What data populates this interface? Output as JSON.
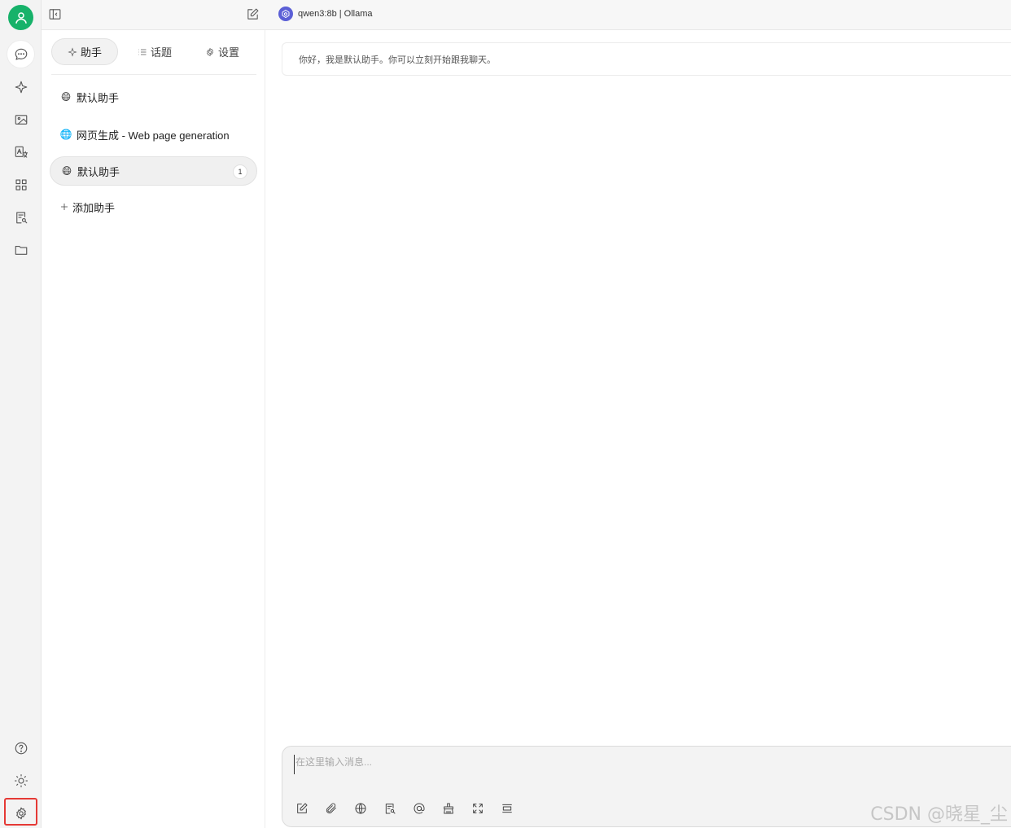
{
  "header": {
    "model_label": "qwen3:8b | Ollama"
  },
  "sidepanel": {
    "tabs": [
      {
        "label": "助手",
        "icon": "sparkle-icon"
      },
      {
        "label": "话题",
        "icon": "list-icon"
      },
      {
        "label": "设置",
        "icon": "gear-icon"
      }
    ],
    "assistants": [
      {
        "name": "默认助手",
        "icon": "grinning-face-emoji",
        "count": ""
      },
      {
        "name": "网页生成 - Web page generation",
        "icon": "globe-emoji",
        "count": ""
      },
      {
        "name": "默认助手",
        "icon": "grinning-face-emoji",
        "count": "1"
      }
    ],
    "add_label": "添加助手"
  },
  "chat": {
    "welcome_message": "你好，我是默认助手。你可以立刻开始跟我聊天。",
    "input_placeholder": "在这里输入消息..."
  },
  "rail": {
    "top_icons": [
      "chat-bubble-icon",
      "sparkle-icon",
      "image-icon",
      "translate-icon",
      "apps-grid-icon",
      "document-search-icon",
      "folder-icon"
    ],
    "bottom_icons": [
      "help-icon",
      "sun-icon",
      "settings-gear-icon"
    ],
    "active": "chat-bubble-icon"
  },
  "composer_tools": [
    "new-topic-icon",
    "attachment-icon",
    "web-search-icon",
    "knowledge-base-icon",
    "mention-icon",
    "clear-icon",
    "expand-icon",
    "more-icon"
  ],
  "watermark": "CSDN @晓星_尘",
  "colors": {
    "avatar": "#17b26a",
    "highlight": "#e53935",
    "model_logo": "#5b5fd6"
  }
}
